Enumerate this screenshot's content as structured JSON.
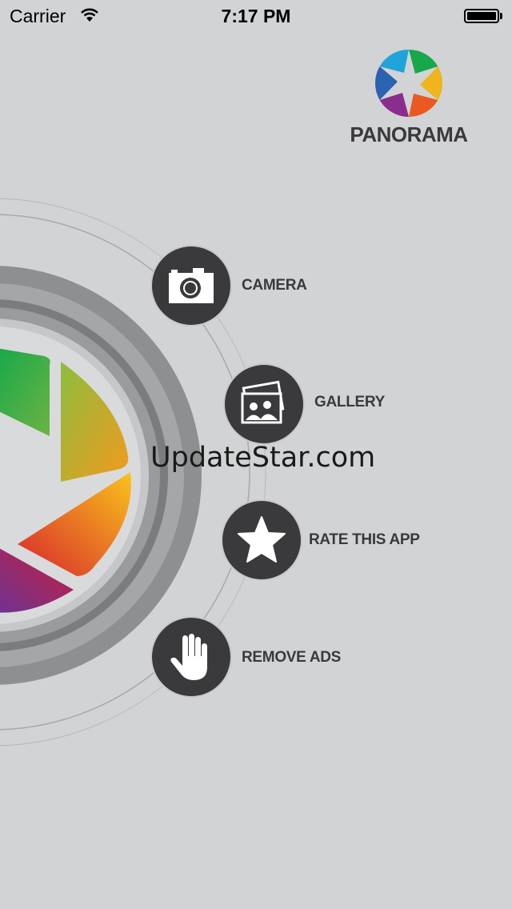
{
  "status_bar": {
    "carrier": "Carrier",
    "time": "7:17 PM"
  },
  "app": {
    "brand_name": "PANORAMA",
    "icon": "aperture-logo-icon"
  },
  "menu": [
    {
      "label": "CAMERA",
      "icon": "camera-icon"
    },
    {
      "label": "GALLERY",
      "icon": "gallery-icon"
    },
    {
      "label": "RATE THIS APP",
      "icon": "star-icon"
    },
    {
      "label": "REMOVE ADS",
      "icon": "hand-icon"
    }
  ],
  "watermark": "UpdateStar.com",
  "colors": {
    "background": "#d2d3d5",
    "button": "#3a3a3c",
    "text": "#3a3a3c"
  }
}
